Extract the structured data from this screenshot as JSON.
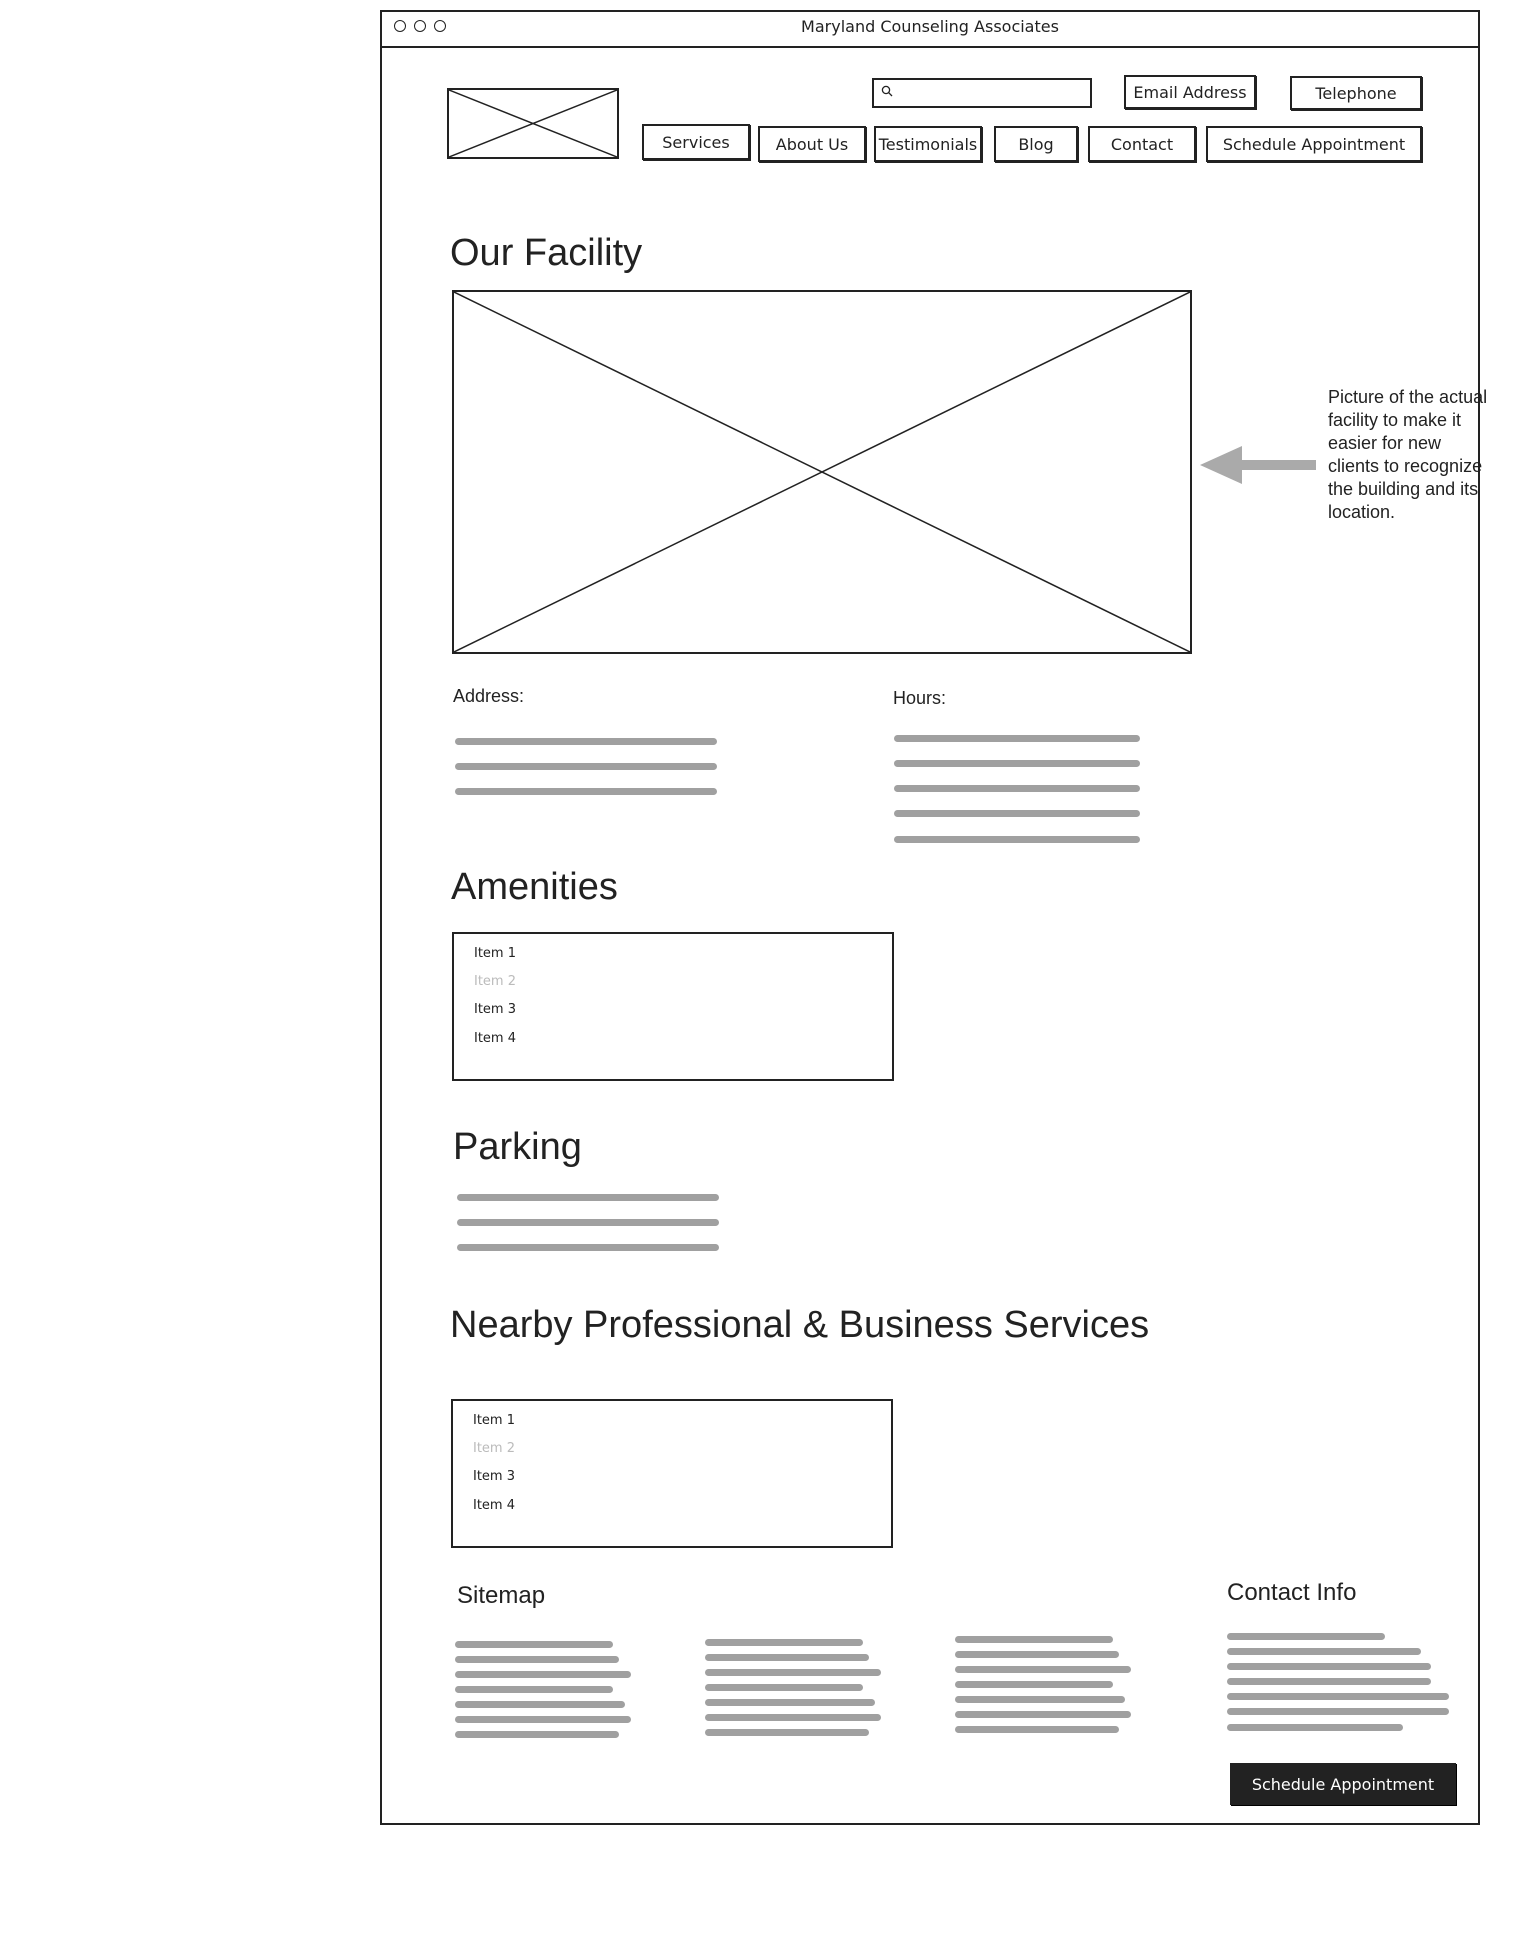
{
  "window": {
    "title": "Maryland Counseling Associates"
  },
  "header": {
    "search": {
      "value": "",
      "placeholder": ""
    },
    "email_label": "Email Address",
    "telephone_label": "Telephone",
    "nav": [
      {
        "label": "Services"
      },
      {
        "label": "About Us"
      },
      {
        "label": "Testimonials"
      },
      {
        "label": "Blog"
      },
      {
        "label": "Contact"
      },
      {
        "label": "Schedule Appointment"
      }
    ]
  },
  "facility": {
    "heading": "Our Facility",
    "annotation": "Picture of the actual facility to make it easier for new clients to recognize the building and its location.",
    "address_label": "Address:",
    "hours_label": "Hours:"
  },
  "amenities": {
    "heading": "Amenities",
    "items": [
      "Item 1",
      "Item 2",
      "Item 3",
      "Item 4"
    ]
  },
  "parking": {
    "heading": "Parking"
  },
  "nearby": {
    "heading": "Nearby Professional & Business Services",
    "items": [
      "Item 1",
      "Item 2",
      "Item 3",
      "Item 4"
    ]
  },
  "footer": {
    "sitemap_label": "Sitemap",
    "contact_label": "Contact Info",
    "cta_label": "Schedule Appointment"
  }
}
